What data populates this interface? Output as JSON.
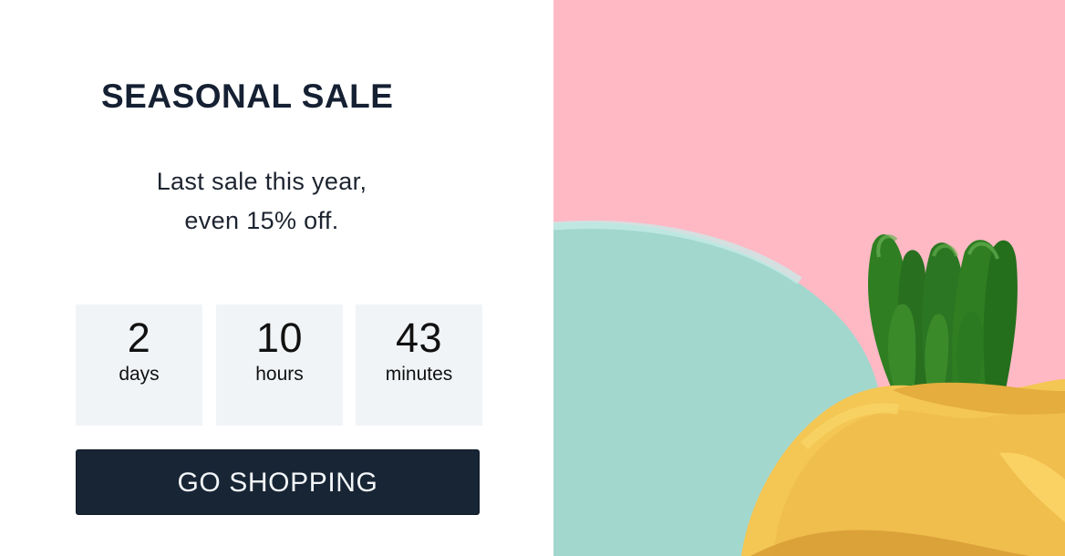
{
  "promo": {
    "title": "SEASONAL SALE",
    "subtitle_line_1": "Last sale this year,",
    "subtitle_line_2": "even 15% off.",
    "button_label": "GO SHOPPING"
  },
  "countdown": {
    "days": {
      "value": "2",
      "label": "days"
    },
    "hours": {
      "value": "10",
      "label": "hours"
    },
    "minutes": {
      "value": "43",
      "label": "minutes"
    }
  },
  "colors": {
    "button_background": "#172535",
    "countdown_background": "#f1f4f7",
    "hero_pink": "#ffb9c5",
    "hero_teal": "#a2d7ce",
    "pot_yellow": "#f4c654",
    "plant_green": "#2f7e22"
  },
  "icons": {
    "hero_image": "potted-succulent-image"
  }
}
